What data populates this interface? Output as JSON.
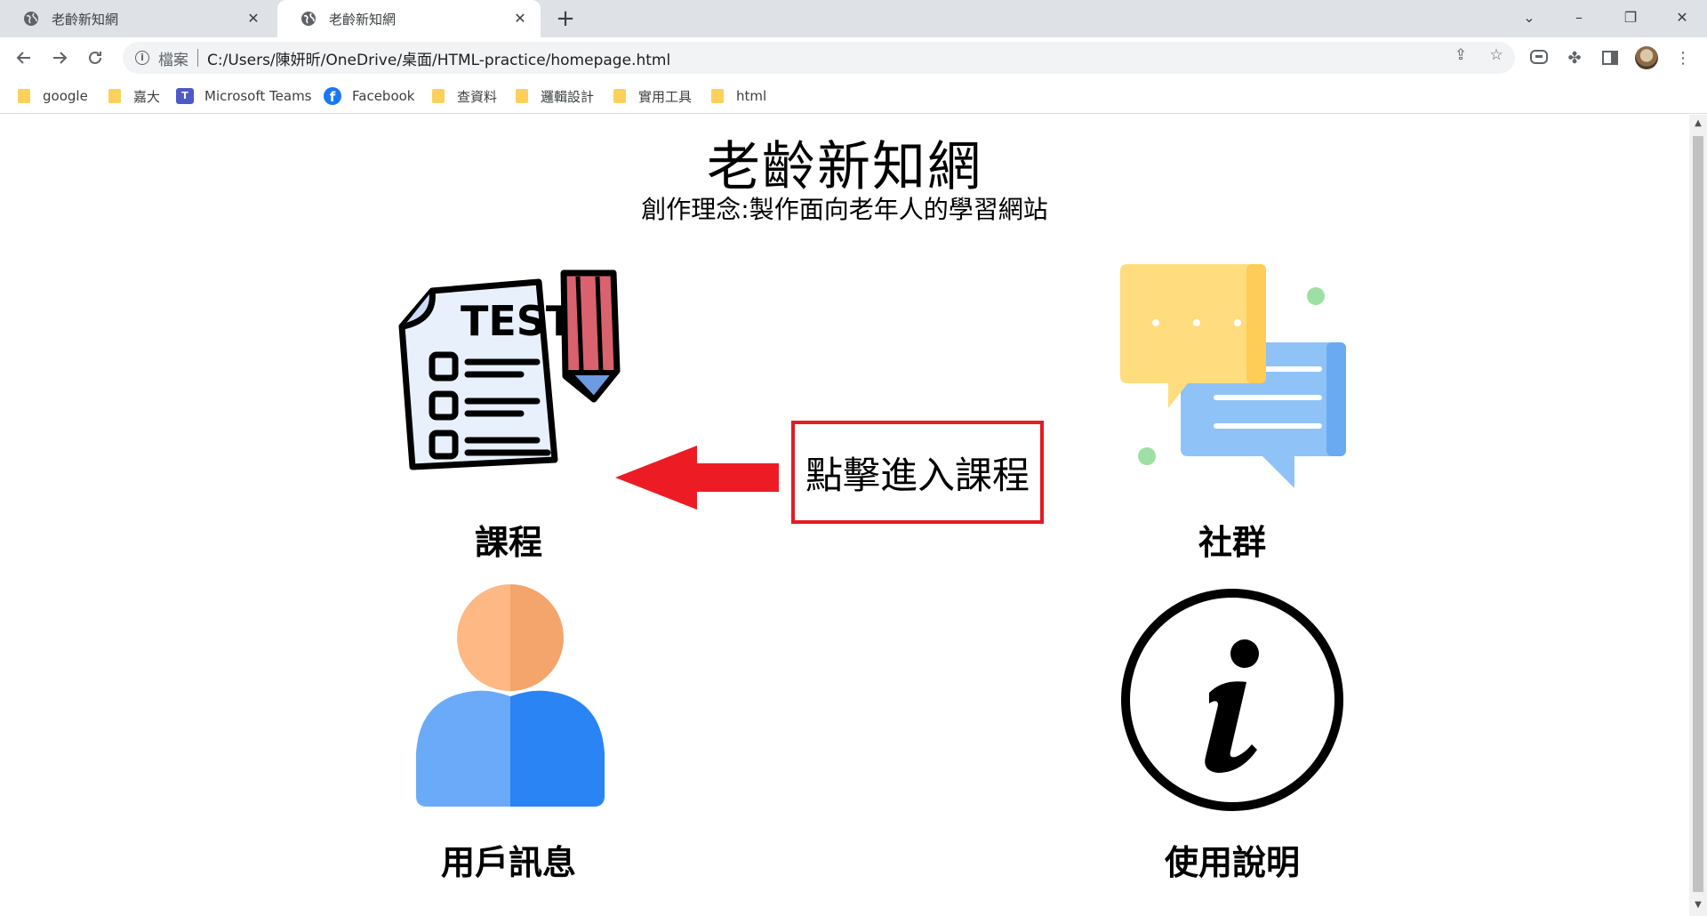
{
  "browser": {
    "tabs": [
      {
        "title": "老齡新知網",
        "active": false
      },
      {
        "title": "老齡新知網",
        "active": true
      }
    ],
    "address": {
      "scheme_label": "檔案",
      "url": "C:/Users/陳妍昕/OneDrive/桌面/HTML-practice/homepage.html"
    },
    "bookmarks": [
      {
        "label": "google",
        "icon": "folder-icon"
      },
      {
        "label": "嘉大",
        "icon": "folder-icon"
      },
      {
        "label": "Microsoft Teams",
        "icon": "teams-icon"
      },
      {
        "label": "Facebook",
        "icon": "facebook-icon"
      },
      {
        "label": "查資料",
        "icon": "folder-icon"
      },
      {
        "label": "邏輯設計",
        "icon": "folder-icon"
      },
      {
        "label": "實用工具",
        "icon": "folder-icon"
      },
      {
        "label": "html",
        "icon": "folder-icon"
      }
    ]
  },
  "page": {
    "title": "老齡新知網",
    "subtitle": "創作理念:製作面向老年人的學習網站",
    "tiles": {
      "course": {
        "label": "課程",
        "icon": "test-paper-icon"
      },
      "community": {
        "label": "社群",
        "icon": "chat-bubbles-icon"
      },
      "user_info": {
        "label": "用戶訊息",
        "icon": "user-icon"
      },
      "help": {
        "label": "使用說明",
        "icon": "info-icon"
      }
    },
    "callout": {
      "text": "點擊進入課程",
      "border_color": "#e31b23",
      "arrow_color": "#ed1c24"
    }
  }
}
